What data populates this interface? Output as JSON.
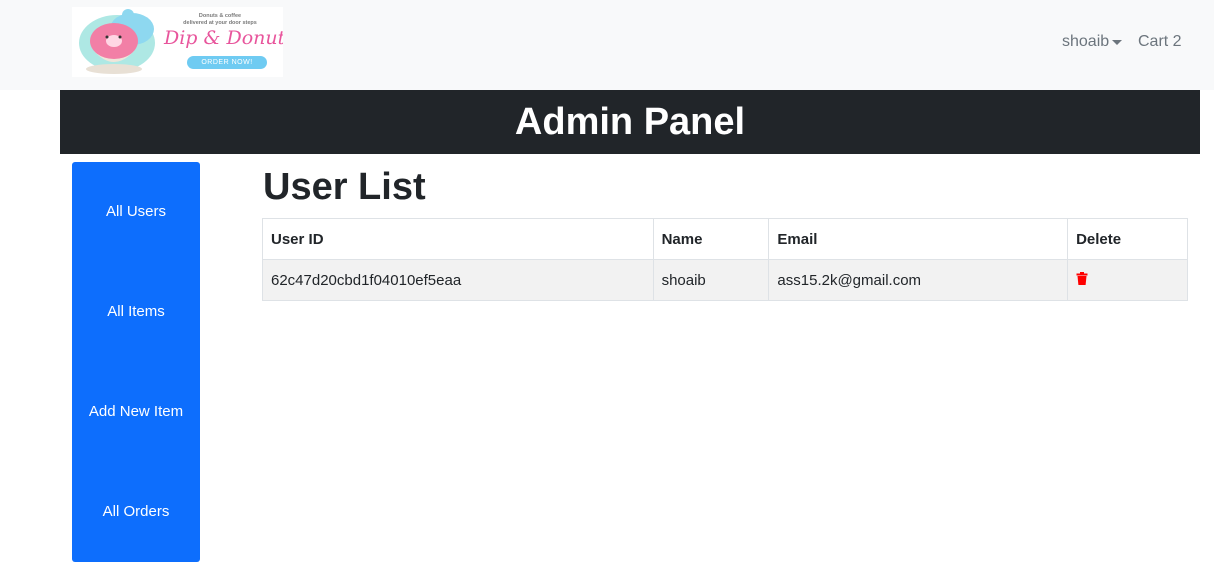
{
  "brand": {
    "tagline_1": "Donuts & coffee",
    "tagline_2": "delivered at your door steps",
    "name": "Dip & Donuts",
    "order_button": "ORDER NOW!"
  },
  "nav": {
    "user": "shoaib",
    "cart": "Cart 2"
  },
  "header": {
    "title": "Admin Panel"
  },
  "sidebar": {
    "items": [
      {
        "label": "All Users"
      },
      {
        "label": "All Items"
      },
      {
        "label": "Add New Item"
      },
      {
        "label": "All Orders"
      }
    ]
  },
  "main": {
    "title": "User List",
    "table": {
      "columns": [
        "User ID",
        "Name",
        "Email",
        "Delete"
      ],
      "rows": [
        {
          "id": "62c47d20cbd1f04010ef5eaa",
          "name": "shoaib",
          "email": "ass15.2k@gmail.com",
          "delete_icon": "trash-icon"
        }
      ]
    }
  },
  "colors": {
    "navbar_bg": "#f8f9fa",
    "header_bg": "#212529",
    "sidebar_bg": "#0d6efd",
    "delete_icon": "#ff0000",
    "logo_pink": "#e8559c",
    "logo_blue": "#6fcbf2"
  }
}
